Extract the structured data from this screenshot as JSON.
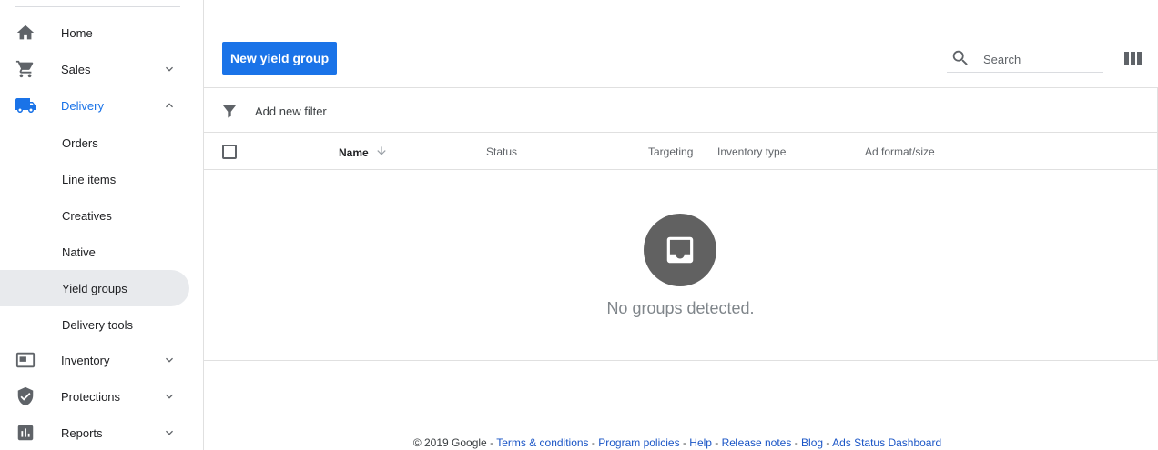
{
  "sidebar": {
    "items": [
      {
        "label": "Home",
        "icon": "home-icon"
      },
      {
        "label": "Sales",
        "icon": "cart-icon"
      },
      {
        "label": "Delivery",
        "icon": "truck-icon"
      },
      {
        "label": "Inventory",
        "icon": "inventory-icon"
      },
      {
        "label": "Protections",
        "icon": "shield-icon"
      },
      {
        "label": "Reports",
        "icon": "bar-chart-icon"
      }
    ],
    "delivery_subitems": [
      {
        "label": "Orders"
      },
      {
        "label": "Line items"
      },
      {
        "label": "Creatives"
      },
      {
        "label": "Native"
      },
      {
        "label": "Yield groups"
      },
      {
        "label": "Delivery tools"
      }
    ]
  },
  "toolbar": {
    "new_button_label": "New yield group",
    "search_placeholder": "Search"
  },
  "filter": {
    "add_label": "Add new filter"
  },
  "table": {
    "columns": [
      "Name",
      "Status",
      "Targeting",
      "Inventory type",
      "Ad format/size"
    ]
  },
  "empty_state": {
    "message": "No groups detected."
  },
  "footer": {
    "copyright": "© 2019 Google",
    "links": [
      "Terms & conditions",
      "Program policies",
      "Help",
      "Release notes",
      "Blog",
      "Ads Status Dashboard"
    ]
  },
  "colors": {
    "accent": "#1a73e8",
    "selected_bg": "#e8eaed",
    "empty_icon_bg": "#616161"
  }
}
